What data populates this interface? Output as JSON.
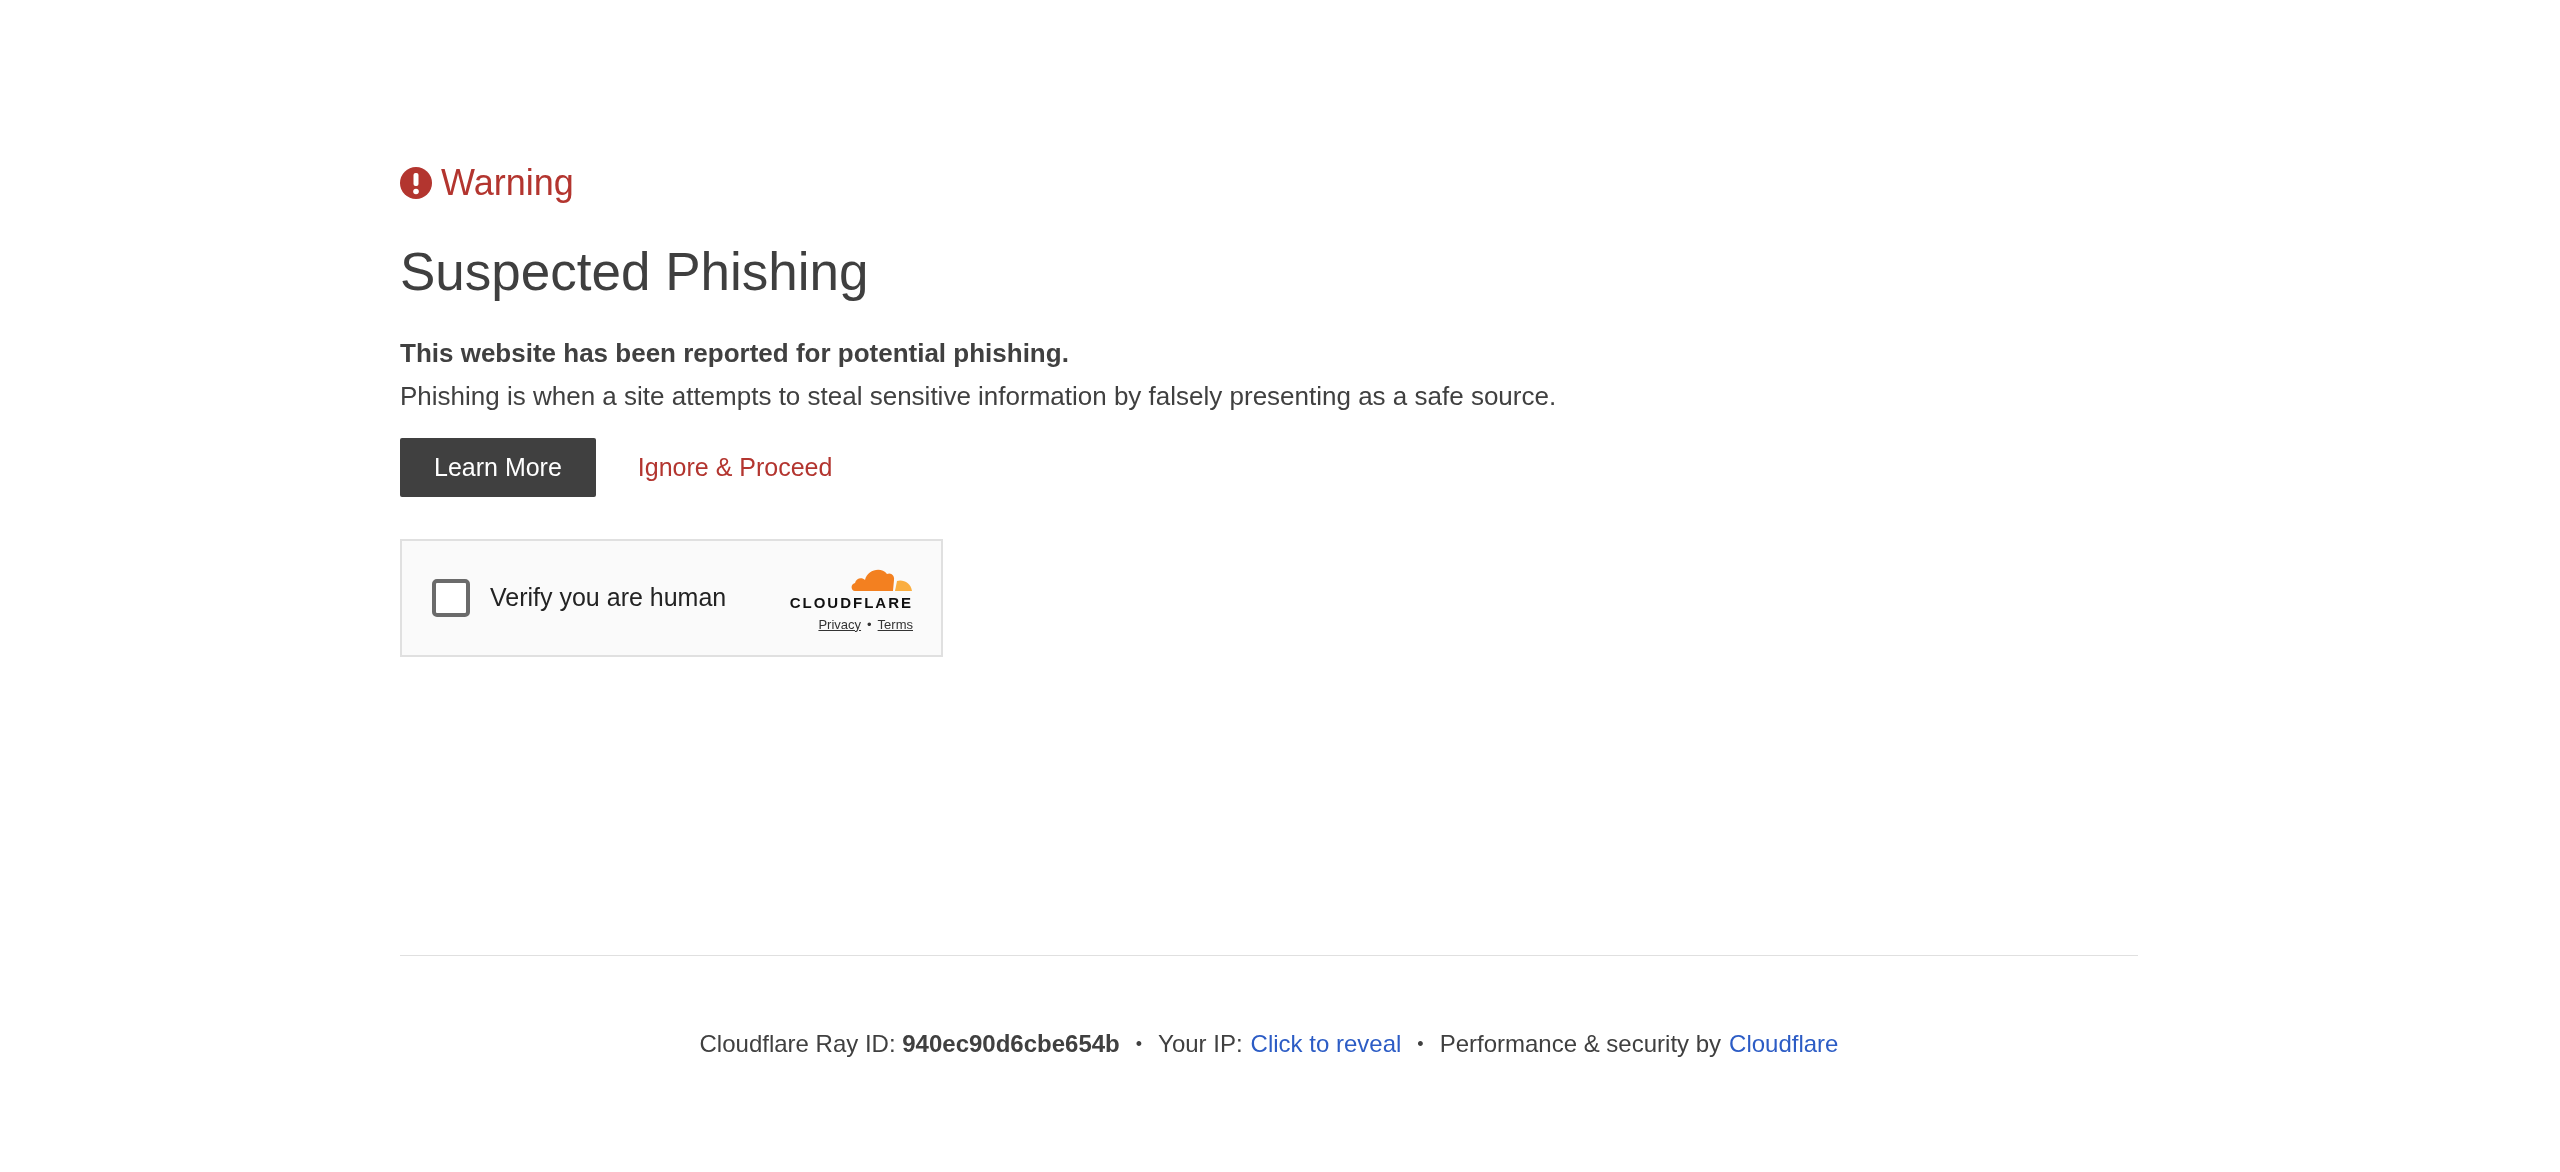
{
  "warning": {
    "label": "Warning"
  },
  "heading": "Suspected Phishing",
  "lead": "This website has been reported for potential phishing.",
  "description": "Phishing is when a site attempts to steal sensitive information by falsely presenting as a safe source.",
  "buttons": [
    {
      "kind": "primary",
      "label": "Learn More"
    },
    {
      "kind": "link",
      "label": "Ignore & Proceed"
    }
  ],
  "captcha": {
    "label": "Verify you are human",
    "checked": false,
    "brand": "CLOUDFLARE",
    "links": [
      {
        "kind": "link",
        "label": "Privacy"
      },
      {
        "kind": "separator",
        "label": "•"
      },
      {
        "kind": "link",
        "label": "Terms"
      }
    ]
  },
  "footer": [
    {
      "kind": "text",
      "label": "Cloudflare Ray ID: **940ec90d6cbe654b**"
    },
    {
      "kind": "separator",
      "label": "•"
    },
    {
      "kind": "text",
      "label": "Your IP:"
    },
    {
      "kind": "link",
      "label": "Click to reveal"
    },
    {
      "kind": "separator",
      "label": "•"
    },
    {
      "kind": "text",
      "label": "Performance & security by"
    },
    {
      "kind": "link",
      "label": "Cloudflare"
    }
  ]
}
